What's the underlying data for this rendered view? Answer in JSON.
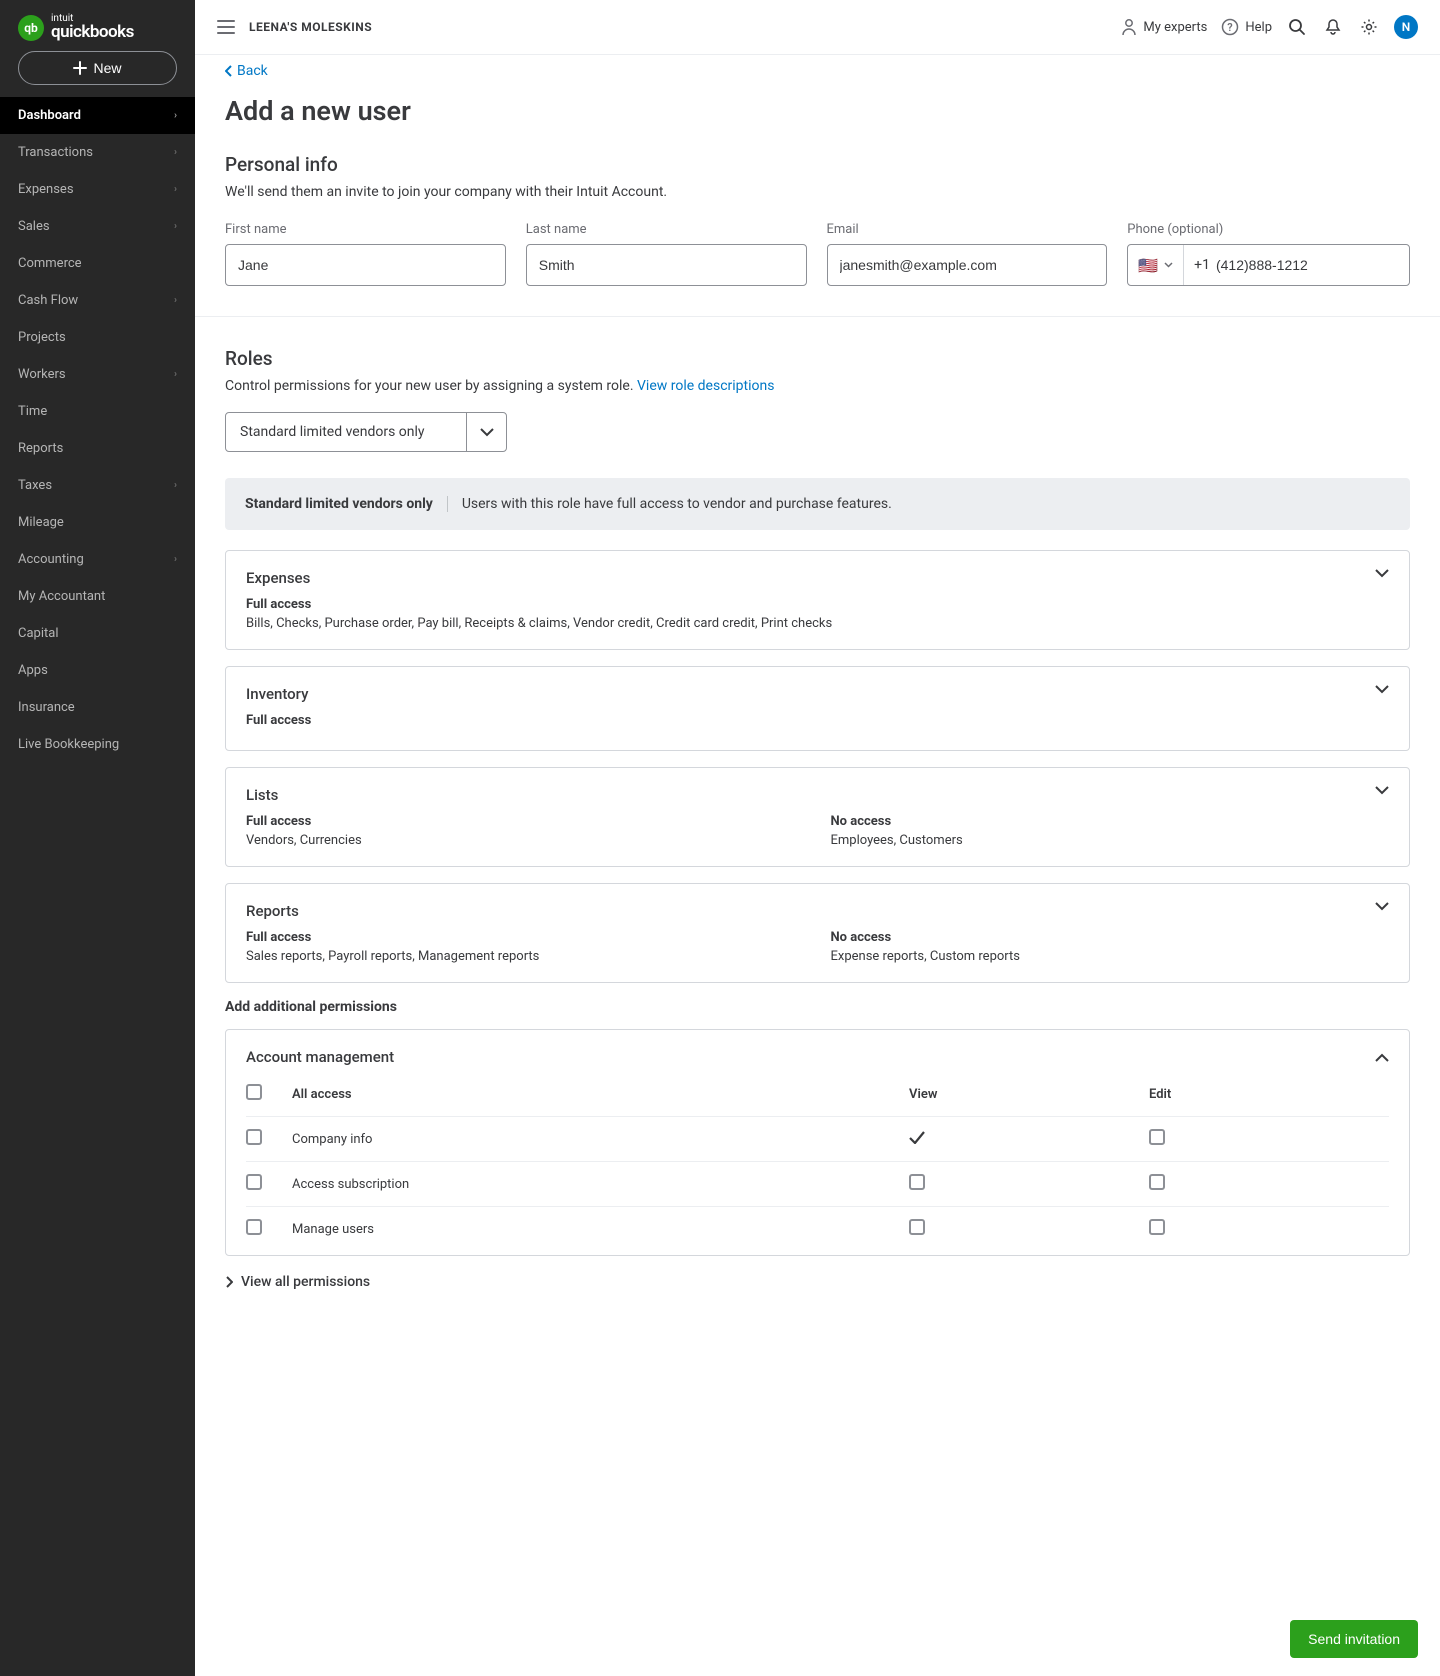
{
  "brand": {
    "top": "intuit",
    "name": "quickbooks",
    "mark": "qb"
  },
  "new_button": "New",
  "sidebar": {
    "items": [
      {
        "label": "Dashboard",
        "chev": true,
        "active": true
      },
      {
        "label": "Transactions",
        "chev": true
      },
      {
        "label": "Expenses",
        "chev": true
      },
      {
        "label": "Sales",
        "chev": true
      },
      {
        "label": "Commerce",
        "chev": false
      },
      {
        "label": "Cash Flow",
        "chev": true
      },
      {
        "label": "Projects",
        "chev": false
      },
      {
        "label": "Workers",
        "chev": true
      },
      {
        "label": "Time",
        "chev": false
      },
      {
        "label": "Reports",
        "chev": false
      },
      {
        "label": "Taxes",
        "chev": true
      },
      {
        "label": "Mileage",
        "chev": false
      },
      {
        "label": "Accounting",
        "chev": true
      },
      {
        "label": "My Accountant",
        "chev": false
      },
      {
        "label": "Capital",
        "chev": false
      },
      {
        "label": "Apps",
        "chev": false
      },
      {
        "label": "Insurance",
        "chev": false
      },
      {
        "label": "Live Bookkeeping",
        "chev": false
      }
    ]
  },
  "topbar": {
    "company": "LEENA'S MOLESKINS",
    "experts": "My experts",
    "help": "Help",
    "avatar_initial": "N"
  },
  "back": "Back",
  "title": "Add a new user",
  "personal": {
    "heading": "Personal info",
    "sub": "We'll send them an invite to join your company with their Intuit Account.",
    "first_label": "First name",
    "first_value": "Jane",
    "last_label": "Last name",
    "last_value": "Smith",
    "email_label": "Email",
    "email_value": "janesmith@example.com",
    "phone_label": "Phone (optional)",
    "phone_prefix": "+1",
    "phone_value": "(412)888-1212"
  },
  "roles": {
    "heading": "Roles",
    "desc": "Control permissions for your new user by assigning a system role. ",
    "link": "View role descriptions",
    "selected": "Standard limited vendors only",
    "banner_name": "Standard limited vendors only",
    "banner_desc": "Users with this role have full access to vendor and purchase features."
  },
  "perm_cards": [
    {
      "title": "Expenses",
      "cols": [
        {
          "level": "Full access",
          "items": "Bills, Checks, Purchase order, Pay bill, Receipts & claims, Vendor credit, Credit card credit, Print checks"
        }
      ]
    },
    {
      "title": "Inventory",
      "cols": [
        {
          "level": "Full access",
          "items": ""
        }
      ]
    },
    {
      "title": "Lists",
      "cols": [
        {
          "level": "Full access",
          "items": "Vendors, Currencies"
        },
        {
          "level": "No access",
          "items": "Employees, Customers"
        }
      ]
    },
    {
      "title": "Reports",
      "cols": [
        {
          "level": "Full access",
          "items": "Sales reports, Payroll reports, Management reports"
        },
        {
          "level": "No access",
          "items": "Expense reports, Custom reports"
        }
      ]
    }
  ],
  "additional": {
    "heading": "Add additional permissions",
    "card_title": "Account management",
    "headers": {
      "all": "All access",
      "view": "View",
      "edit": "Edit"
    },
    "rows": [
      {
        "name": "Company info",
        "view_check": true
      },
      {
        "name": "Access subscription",
        "view_check": false
      },
      {
        "name": "Manage users",
        "view_check": false
      }
    ]
  },
  "view_all": "View all permissions",
  "send": "Send invitation"
}
